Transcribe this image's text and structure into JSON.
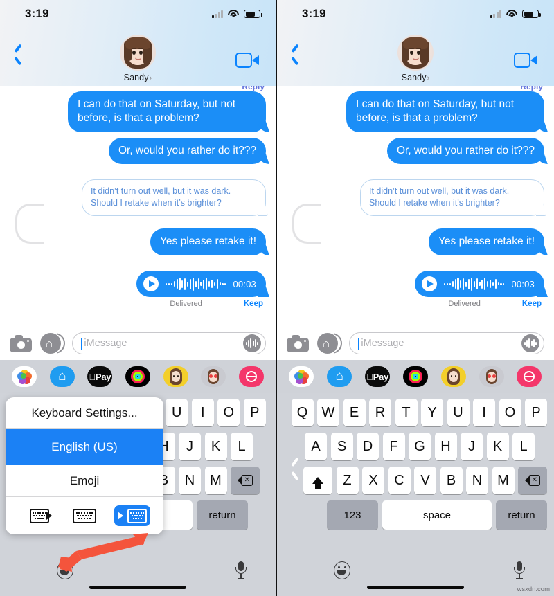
{
  "status_bar": {
    "time": "3:19",
    "signal_icon": "cellular-bars-icon",
    "wifi_icon": "wifi-icon",
    "battery_icon": "battery-icon"
  },
  "nav": {
    "back_icon": "chevron-left-icon",
    "contact_name": "Sandy",
    "contact_chevron": "›",
    "avatar_name": "memoji-avatar",
    "facetime_icon": "video-camera-icon"
  },
  "conversation": {
    "cut_reply_label": "Reply",
    "messages": [
      {
        "id": "m1",
        "kind": "outgoing-blue",
        "text": "I can do that on Saturday, but not before, is that a problem?"
      },
      {
        "id": "m2",
        "kind": "outgoing-blue",
        "text": "Or, would you rather do it???"
      },
      {
        "id": "m3",
        "kind": "outgoing-outline",
        "text": "It didn’t turn out well, but it was dark. Should I retake when it’s brighter?"
      },
      {
        "id": "m4",
        "kind": "outgoing-blue",
        "text": "Yes please retake it!"
      }
    ],
    "audio_message": {
      "play_icon": "play-icon",
      "waveform_icon": "audio-waveform-icon",
      "duration": "00:03",
      "status": "Delivered",
      "keep_label": "Keep"
    }
  },
  "input_bar": {
    "camera_icon": "camera-icon",
    "app_store_icon": "app-store-icon",
    "placeholder": "iMessage",
    "value": "",
    "audio_icon": "audio-waveform-button-icon"
  },
  "app_drawer": {
    "items": [
      {
        "name": "photos-app-icon",
        "label": "Photos"
      },
      {
        "name": "app-store-app-icon",
        "label": "Store"
      },
      {
        "name": "apple-pay-app-icon",
        "label": "Pay"
      },
      {
        "name": "fitness-app-icon",
        "label": "Fitness"
      },
      {
        "name": "memoji-app-icon",
        "label": "Memoji"
      },
      {
        "name": "memoji-stickers-app-icon",
        "label": "Stickers"
      },
      {
        "name": "image-search-app-icon",
        "label": "#images"
      }
    ]
  },
  "keyboard": {
    "row1": [
      "Q",
      "W",
      "E",
      "R",
      "T",
      "Y",
      "U",
      "I",
      "O",
      "P"
    ],
    "row2": [
      "A",
      "S",
      "D",
      "F",
      "G",
      "H",
      "J",
      "K",
      "L"
    ],
    "row3": [
      "Z",
      "X",
      "C",
      "V",
      "B",
      "N",
      "M"
    ],
    "shift_icon": "shift-arrow-icon",
    "backspace_icon": "backspace-icon",
    "numbers_label": "123",
    "space_label": "space",
    "return_label": "return",
    "onehand_expand_icon": "chevron-left-icon"
  },
  "bottom_bar": {
    "emoji_icon": "emoji-smiley-icon",
    "dictation_icon": "microphone-icon",
    "home_indicator": "home-indicator"
  },
  "popup": {
    "title": "Keyboard Settings...",
    "selected_item": "English (US)",
    "items": [
      "Emoji"
    ],
    "layout_buttons": [
      {
        "name": "keyboard-left-handed-button",
        "active": false
      },
      {
        "name": "keyboard-full-width-button",
        "active": false
      },
      {
        "name": "keyboard-right-handed-button",
        "active": true
      }
    ]
  },
  "annotation": {
    "arrow_name": "red-double-arrow",
    "color": "#f4543c"
  },
  "watermark": {
    "text": "wsxdn.com"
  },
  "colors": {
    "imessage_blue": "#1b8ef7",
    "accent_blue": "#0b84fe",
    "keyboard_bg": "#d0d3d9",
    "key_gray": "#a4a8b2"
  }
}
